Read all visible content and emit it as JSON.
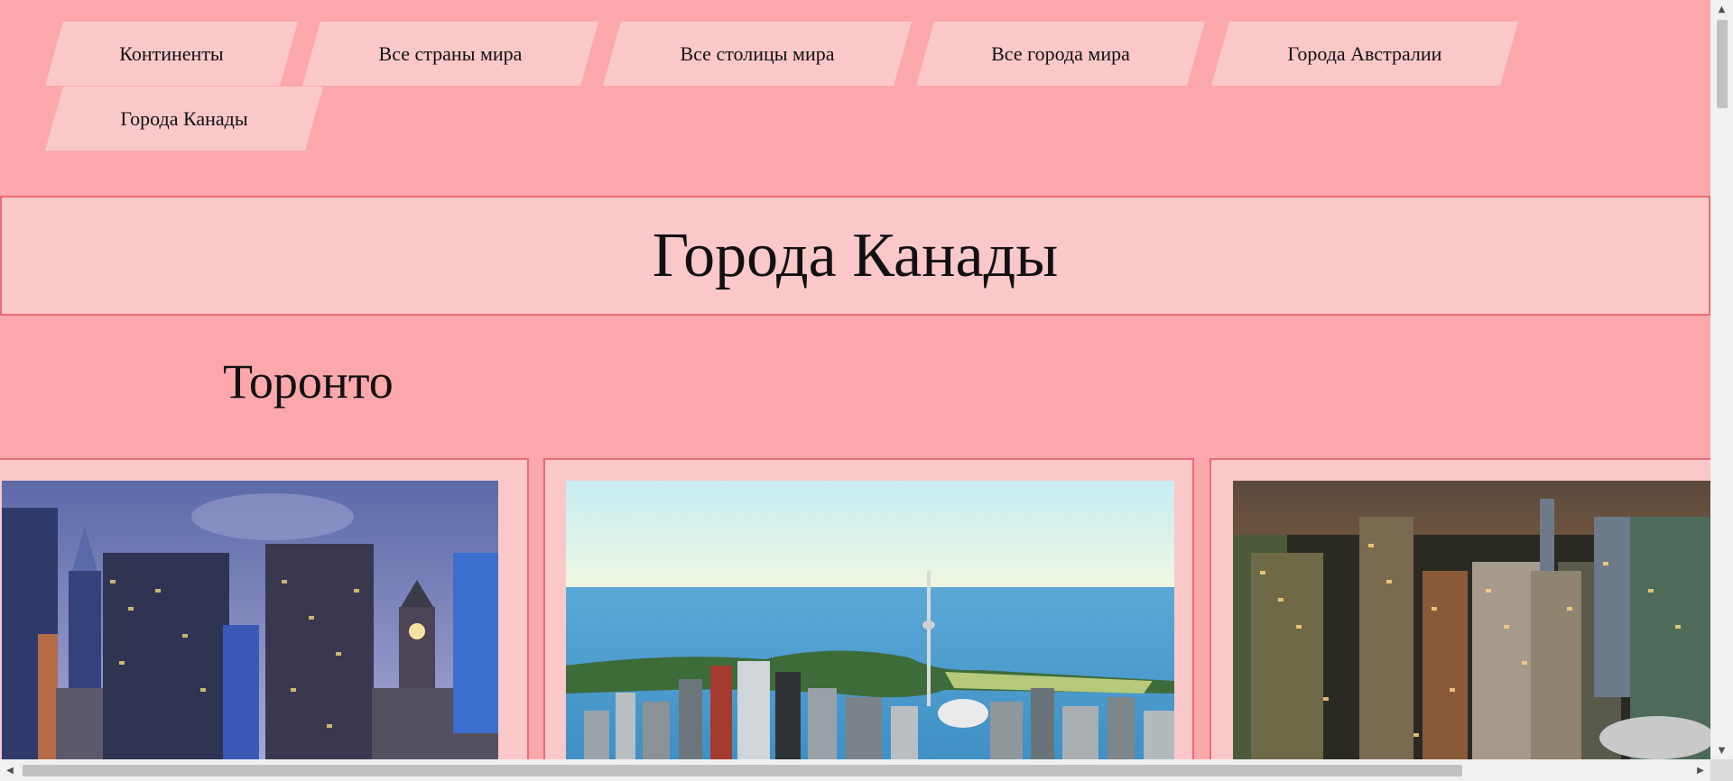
{
  "nav": {
    "items": [
      {
        "label": "Континенты"
      },
      {
        "label": "Все страны мира"
      },
      {
        "label": "Все столицы мира"
      },
      {
        "label": "Все города мира"
      },
      {
        "label": "Города Австралии"
      },
      {
        "label": "Города Канады"
      }
    ]
  },
  "page": {
    "title": "Города Канады",
    "city": "Торонто"
  },
  "colors": {
    "background": "#fca7ac",
    "panel": "#fbc8ca",
    "border": "#ec6b74"
  },
  "scrollbars": {
    "up_icon": "chevron-up-icon",
    "down_icon": "chevron-down-icon",
    "left_icon": "chevron-left-icon",
    "right_icon": "chevron-right-icon"
  }
}
